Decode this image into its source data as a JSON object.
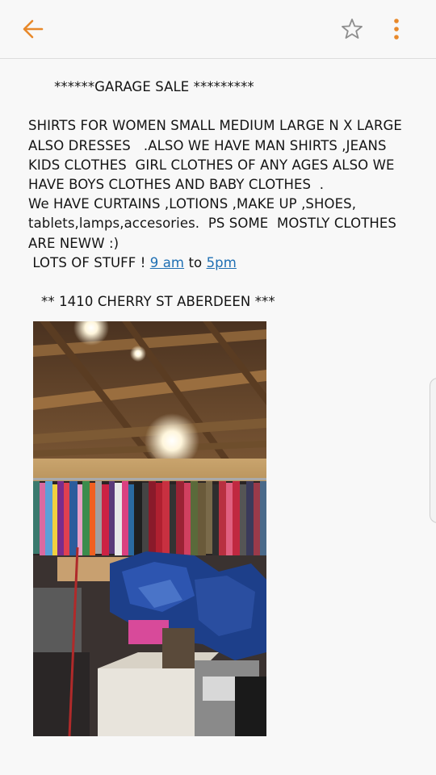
{
  "toolbar": {
    "back_icon": "arrow-left-icon",
    "star_icon": "star-outline-icon",
    "more_icon": "more-vertical-icon",
    "accent_color": "#e8892b"
  },
  "post": {
    "line1": "      ******GARAGE SALE *********",
    "line2": "",
    "line3": "SHIRTS FOR WOMEN SMALL MEDIUM LARGE N X LARGE",
    "line4": "ALSO DRESSES   .ALSO WE HAVE MAN SHIRTS ,JEANS",
    "line5": "KIDS CLOTHES  GIRL CLOTHES OF ANY AGES ALSO WE",
    "line6": "HAVE BOYS CLOTHES AND BABY CLOTHES  .",
    "line7": "We HAVE CURTAINS ,LOTIONS ,MAKE UP ,SHOES,",
    "line8": "tablets,lamps,accesories.  PS SOME  MOSTLY CLOTHES",
    "line9": "ARE NEWW :)",
    "line10_prefix": " LOTS OF STUFF ! ",
    "time_start": "9 am",
    "time_mid": " to ",
    "time_end": "5pm",
    "line11": "",
    "address": "   ** 1410 CHERRY ST ABERDEEN ***"
  },
  "photo": {
    "icon": "garage-sale-photo"
  }
}
